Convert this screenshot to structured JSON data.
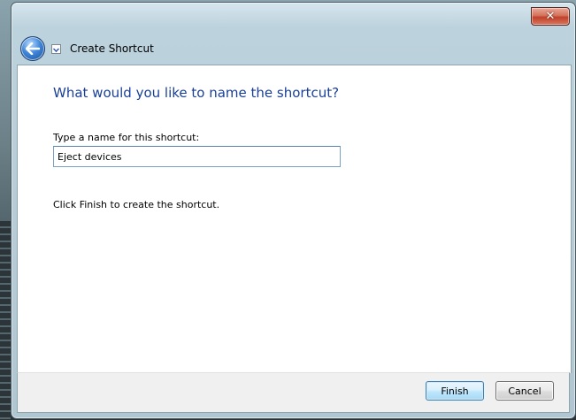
{
  "window": {
    "title": "Create Shortcut",
    "close_glyph": "✕"
  },
  "icons": {
    "back": "back-arrow-icon",
    "shortcut": "shortcut-icon",
    "close": "close-icon"
  },
  "main": {
    "heading": "What would you like to name the shortcut?",
    "name_label": "Type a name for this shortcut:",
    "name_value": "Eject devices",
    "finish_hint": "Click Finish to create the shortcut."
  },
  "footer": {
    "finish_label": "Finish",
    "cancel_label": "Cancel"
  },
  "colors": {
    "heading": "#1a3f99",
    "finish_border": "#3c7fb1",
    "close_red": "#c0412a"
  }
}
